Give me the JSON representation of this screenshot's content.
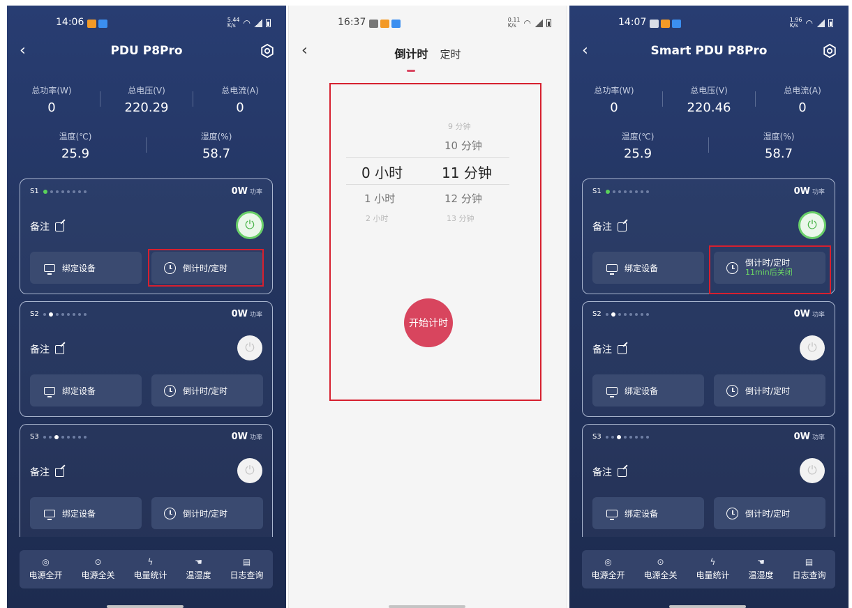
{
  "left_screen": {
    "time": "14:06",
    "title": "PDU P8Pro",
    "metrics": [
      {
        "label": "总功率(W)",
        "value": "0"
      },
      {
        "label": "总电压(V)",
        "value": "220.29"
      },
      {
        "label": "总电流(A)",
        "value": "0"
      },
      {
        "label": "温度(℃)",
        "value": "25.9"
      },
      {
        "label": "湿度(%)",
        "value": "58.7"
      }
    ],
    "cards": [
      {
        "id": "S1",
        "power": "0W",
        "power_unit": "功率",
        "remark": "备注",
        "bind": "绑定设备",
        "timer": "倒计时/定时"
      },
      {
        "id": "S2",
        "power": "0W",
        "power_unit": "功率",
        "remark": "备注",
        "bind": "绑定设备",
        "timer": "倒计时/定时"
      },
      {
        "id": "S3",
        "power": "0W",
        "power_unit": "功率",
        "remark": "备注",
        "bind": "绑定设备",
        "timer": "倒计时/定时"
      }
    ],
    "bottom": [
      "电源全开",
      "电源全关",
      "电量统计",
      "温湿度",
      "日志查询"
    ]
  },
  "middle_screen": {
    "time": "16:37",
    "tab_countdown": "倒计时",
    "tab_schedule": "定时",
    "picker": {
      "minutes_far_above": "9 分钟",
      "minutes_above": "10 分钟",
      "hours_selected": "0 小时",
      "minutes_selected": "11 分钟",
      "hours_below": "1 小时",
      "minutes_below": "12 分钟",
      "hours_far_below": "2 小时",
      "minutes_far_below": "13 分钟"
    },
    "start_label": "开始计时"
  },
  "right_screen": {
    "time": "14:07",
    "title": "Smart PDU P8Pro",
    "metrics": [
      {
        "label": "总功率(W)",
        "value": "0"
      },
      {
        "label": "总电压(V)",
        "value": "220.46"
      },
      {
        "label": "总电流(A)",
        "value": "0"
      },
      {
        "label": "温度(℃)",
        "value": "25.9"
      },
      {
        "label": "湿度(%)",
        "value": "58.7"
      }
    ],
    "cards": [
      {
        "id": "S1",
        "power": "0W",
        "power_unit": "功率",
        "remark": "备注",
        "bind": "绑定设备",
        "timer": "倒计时/定时",
        "timer_status": "11min后关闭"
      },
      {
        "id": "S2",
        "power": "0W",
        "power_unit": "功率",
        "remark": "备注",
        "bind": "绑定设备",
        "timer": "倒计时/定时"
      },
      {
        "id": "S3",
        "power": "0W",
        "power_unit": "功率",
        "remark": "备注",
        "bind": "绑定设备",
        "timer": "倒计时/定时"
      }
    ],
    "bottom": [
      "电源全开",
      "电源全关",
      "电量统计",
      "温湿度",
      "日志查询"
    ]
  },
  "colors": {
    "accent": "#d8455e",
    "power_on": "#69cf69",
    "highlight": "#d6202f",
    "panel_bg": "#23345f"
  },
  "icons": [
    "back-icon",
    "settings-icon",
    "edit-icon",
    "power-icon",
    "monitor-icon",
    "alarm-clock-icon",
    "power-on-icon",
    "power-off-icon",
    "chart-icon",
    "hand-icon",
    "log-icon"
  ]
}
